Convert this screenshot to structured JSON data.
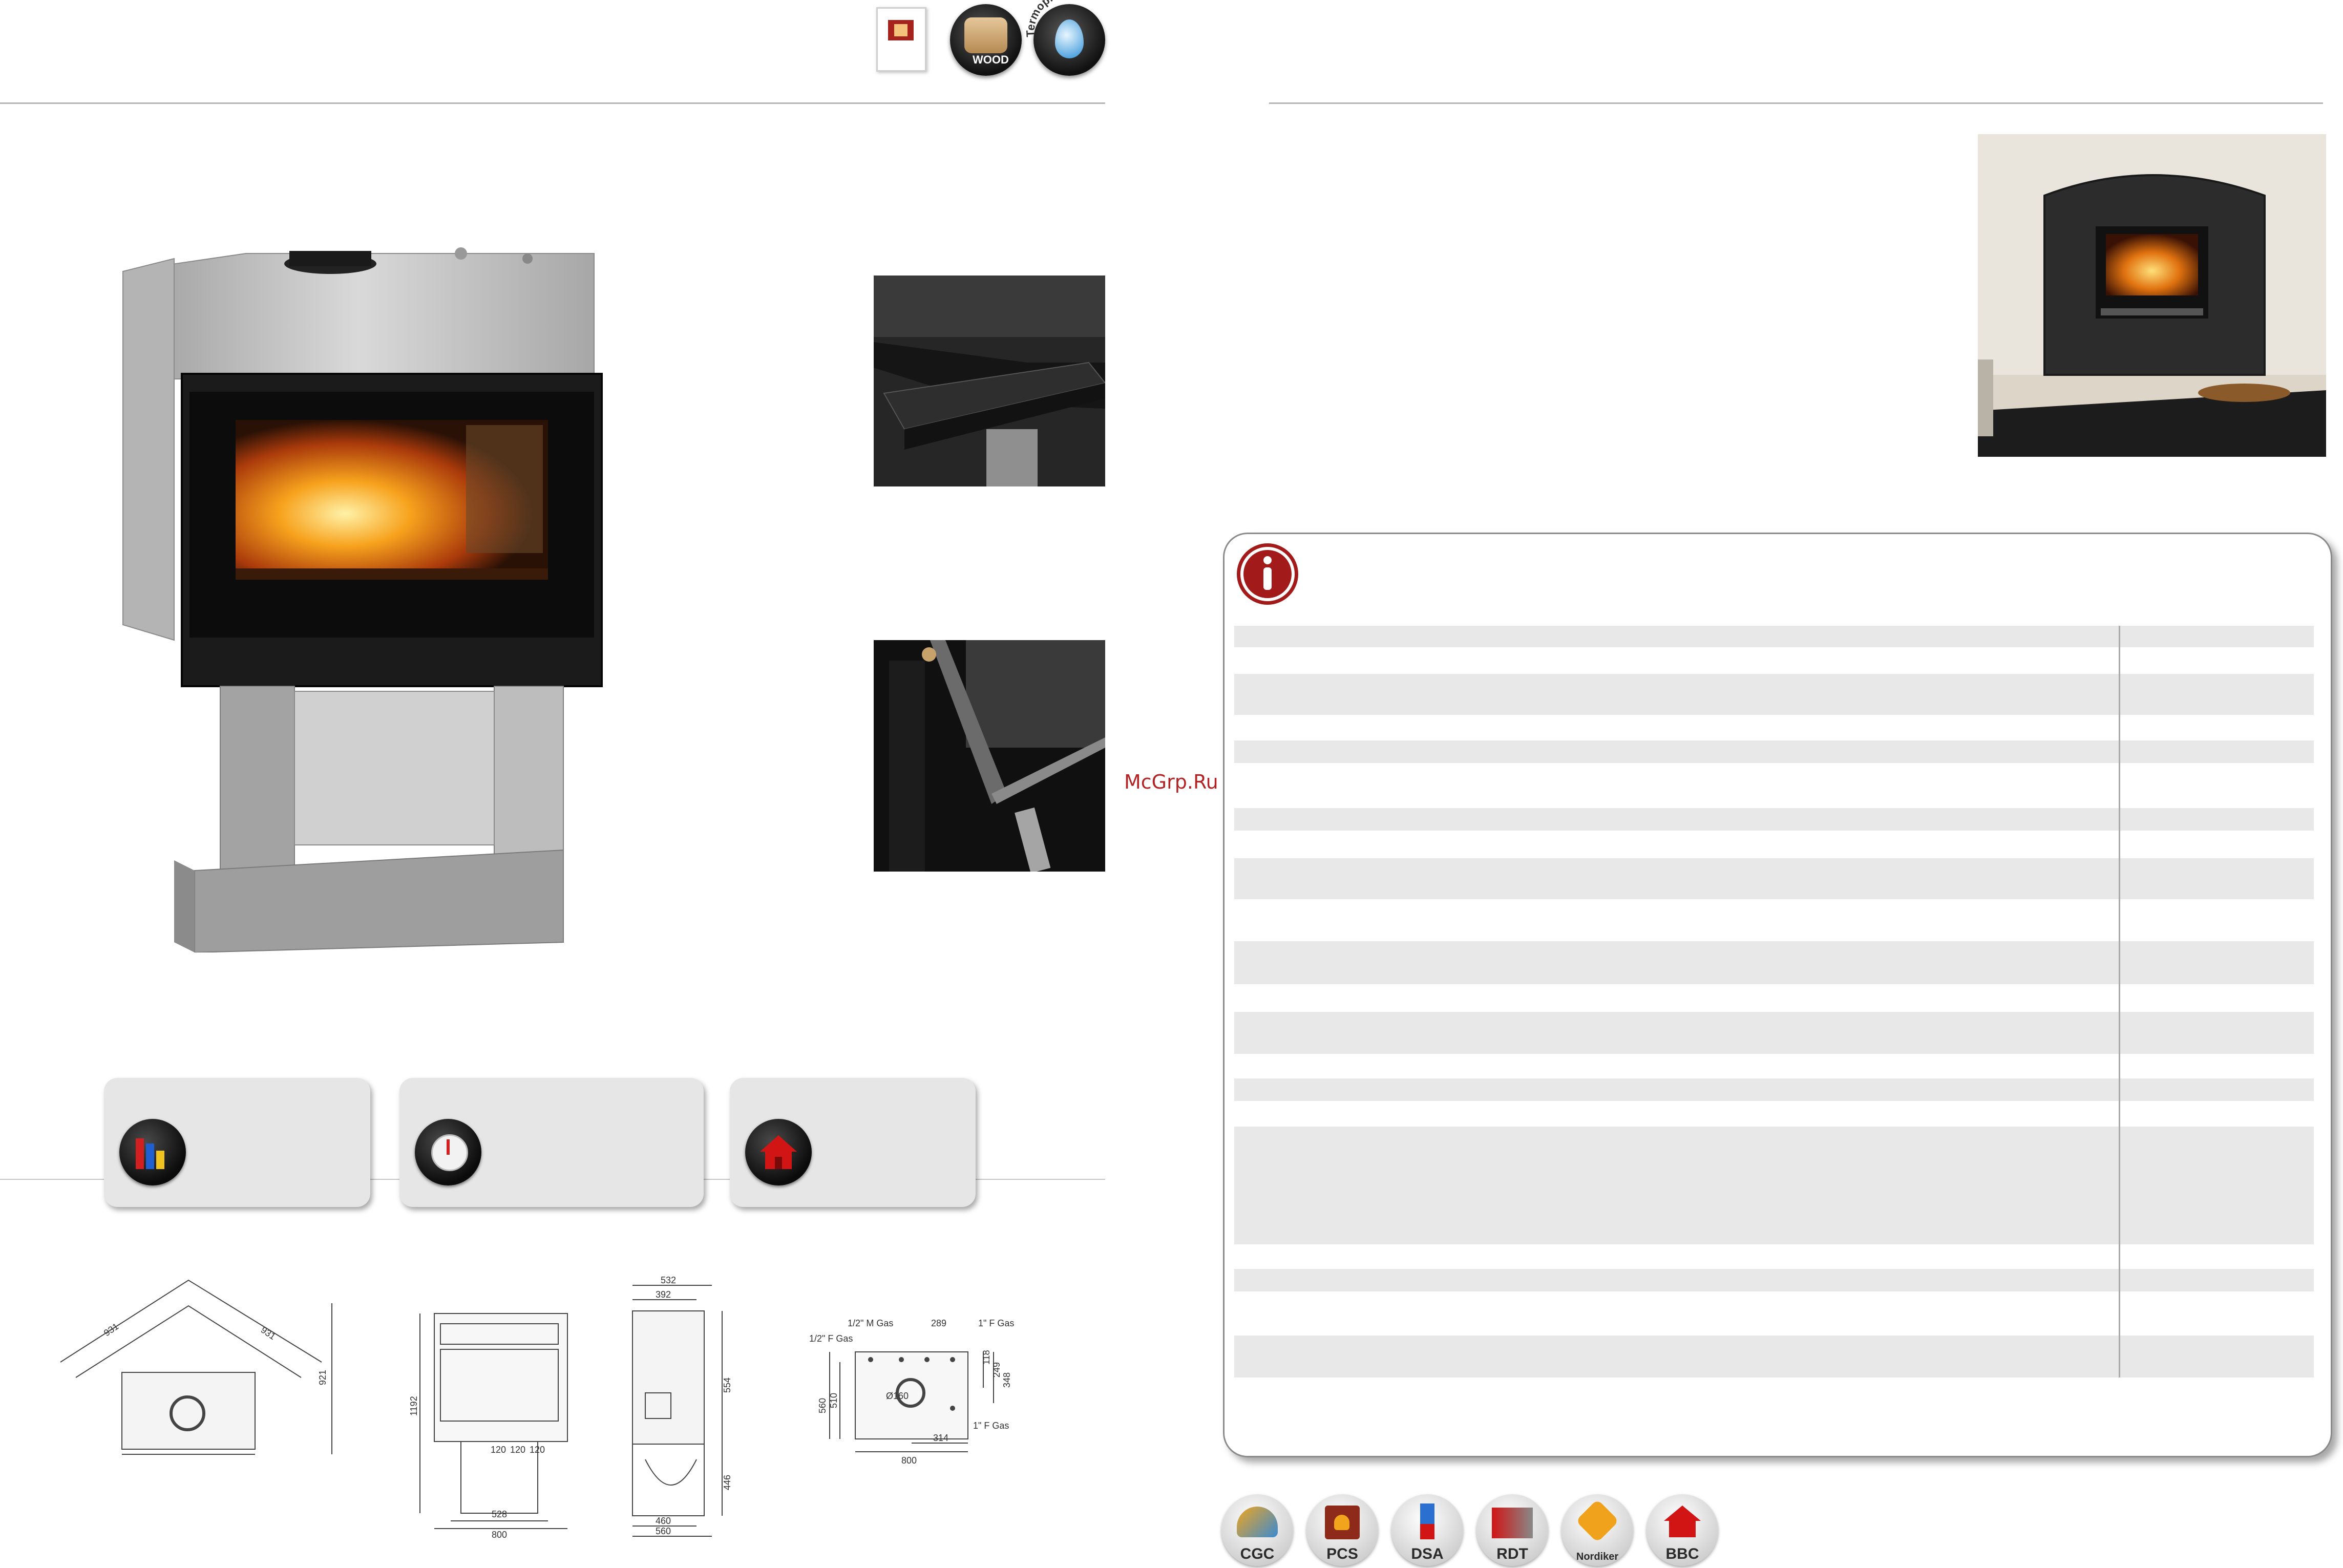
{
  "header": {
    "wood_label": "WOOD",
    "termo_label": "Termoprodotti"
  },
  "watermark": "McGrp.Ru",
  "drawings": {
    "corner": {
      "dims": [
        "931",
        "931",
        "921"
      ]
    },
    "front": {
      "dims": [
        "1192",
        "120",
        "120",
        "120",
        "528",
        "800"
      ]
    },
    "side": {
      "dims": [
        "532",
        "392",
        "554",
        "446",
        "460",
        "560"
      ]
    },
    "top": {
      "dims": [
        "1/2\" M Gas",
        "289",
        "1\" F Gas",
        "1/2\" F Gas",
        "118",
        "249",
        "348",
        "510",
        "560",
        "Ø160",
        "1\" F Gas",
        "314",
        "800"
      ]
    }
  },
  "badges": [
    {
      "label": "CGC",
      "icon": "cgc-badge-icon"
    },
    {
      "label": "PCS",
      "icon": "pcs-badge-icon"
    },
    {
      "label": "DSA",
      "icon": "dsa-badge-icon"
    },
    {
      "label": "RDT",
      "icon": "rdt-badge-icon"
    },
    {
      "label": "Nordiker",
      "icon": "nordiker-badge-icon"
    },
    {
      "label": "BBC",
      "icon": "bbc-badge-icon"
    }
  ],
  "colors": {
    "info_red": "#a31a1a",
    "home_red": "#d11515",
    "stripe_gray": "#e8e8e8"
  }
}
